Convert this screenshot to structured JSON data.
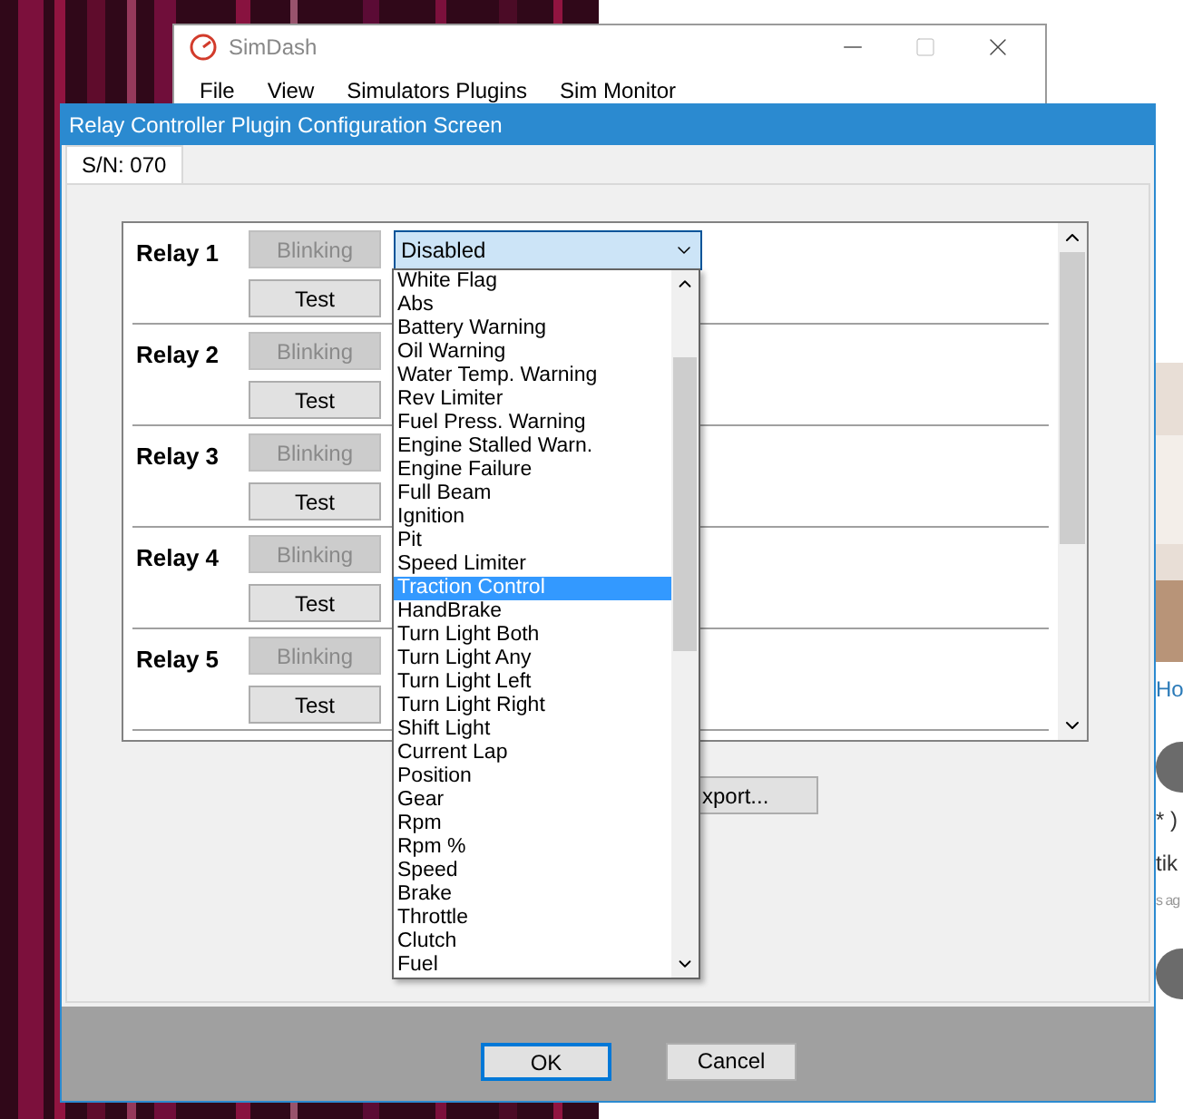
{
  "background_page": {
    "fragments": [
      {
        "kind": "link",
        "text": "Ho"
      },
      {
        "kind": "avatar"
      },
      {
        "kind": "text",
        "text": "* )"
      },
      {
        "kind": "text",
        "text": "tik"
      },
      {
        "kind": "meta",
        "text": "s ag"
      },
      {
        "kind": "avatar"
      }
    ]
  },
  "main_window": {
    "title": "SimDash",
    "menu": [
      "File",
      "View",
      "Simulators Plugins",
      "Sim Monitor"
    ]
  },
  "dialog": {
    "title": "Relay Controller Plugin Configuration Screen",
    "tabs": [
      {
        "label": "S/N: 070",
        "selected": true
      }
    ],
    "relays": [
      {
        "label": "Relay 1",
        "blink_button": "Blinking",
        "blink_disabled": true,
        "test_button": "Test"
      },
      {
        "label": "Relay 2",
        "blink_button": "Blinking",
        "blink_disabled": true,
        "test_button": "Test"
      },
      {
        "label": "Relay 3",
        "blink_button": "Blinking",
        "blink_disabled": true,
        "test_button": "Test"
      },
      {
        "label": "Relay 4",
        "blink_button": "Blinking",
        "blink_disabled": true,
        "test_button": "Test"
      },
      {
        "label": "Relay 5",
        "blink_button": "Blinking",
        "blink_disabled": true,
        "test_button": "Test"
      }
    ],
    "mode_select": {
      "value": "Disabled",
      "expanded": true
    },
    "dropdown_options": [
      {
        "label": "White Flag",
        "selected": false
      },
      {
        "label": "Abs",
        "selected": false
      },
      {
        "label": "Battery Warning",
        "selected": false
      },
      {
        "label": "Oil Warning",
        "selected": false
      },
      {
        "label": "Water Temp. Warning",
        "selected": false
      },
      {
        "label": "Rev Limiter",
        "selected": false
      },
      {
        "label": "Fuel Press. Warning",
        "selected": false
      },
      {
        "label": "Engine Stalled Warn.",
        "selected": false
      },
      {
        "label": "Engine Failure",
        "selected": false
      },
      {
        "label": "Full Beam",
        "selected": false
      },
      {
        "label": "Ignition",
        "selected": false
      },
      {
        "label": "Pit",
        "selected": false
      },
      {
        "label": "Speed Limiter",
        "selected": false
      },
      {
        "label": "Traction Control",
        "selected": true
      },
      {
        "label": "HandBrake",
        "selected": false
      },
      {
        "label": "Turn Light Both",
        "selected": false
      },
      {
        "label": "Turn Light Any",
        "selected": false
      },
      {
        "label": "Turn Light Left",
        "selected": false
      },
      {
        "label": "Turn Light Right",
        "selected": false
      },
      {
        "label": "Shift Light",
        "selected": false
      },
      {
        "label": "Current Lap",
        "selected": false
      },
      {
        "label": "Position",
        "selected": false
      },
      {
        "label": "Gear",
        "selected": false
      },
      {
        "label": "Rpm",
        "selected": false
      },
      {
        "label": "Rpm %",
        "selected": false
      },
      {
        "label": "Speed",
        "selected": false
      },
      {
        "label": "Brake",
        "selected": false
      },
      {
        "label": "Throttle",
        "selected": false
      },
      {
        "label": "Clutch",
        "selected": false
      },
      {
        "label": "Fuel",
        "selected": false
      }
    ],
    "export_button": "xport...",
    "buttons": [
      {
        "label": "OK",
        "default": true
      },
      {
        "label": "Cancel",
        "default": false
      }
    ]
  }
}
